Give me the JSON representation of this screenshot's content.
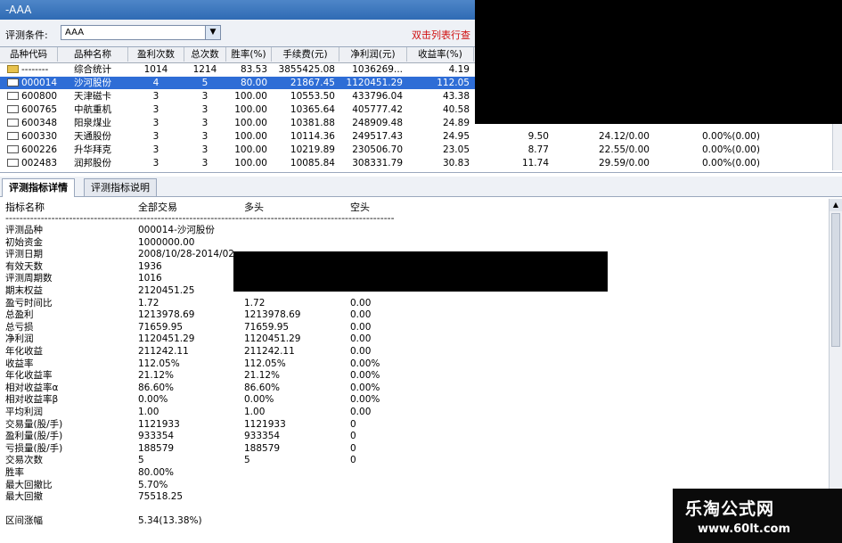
{
  "window": {
    "title": "-AAA"
  },
  "condition": {
    "label": "评测条件:",
    "value": "AAA",
    "hint": "双击列表行查"
  },
  "grid": {
    "headers": [
      "品种代码",
      "品种名称",
      "盈利次数",
      "总次数",
      "胜率(%)",
      "手续费(元)",
      "净利润(元)",
      "收益率(%)"
    ],
    "rows": [
      {
        "code": "--------",
        "name": "综合统计",
        "wins": "1014",
        "total": "1214",
        "rate": "83.53",
        "fee": "3855425.08",
        "profit": "1036269...",
        "ret": "4.19",
        "c9": "",
        "c10": "",
        "c11": "",
        "icon": "folder"
      },
      {
        "code": "000014",
        "name": "沙河股份",
        "wins": "4",
        "total": "5",
        "rate": "80.00",
        "fee": "21867.45",
        "profit": "1120451.29",
        "ret": "112.05",
        "c9": "",
        "c10": "",
        "c11": "",
        "icon": "doc"
      },
      {
        "code": "600800",
        "name": "天津磁卡",
        "wins": "3",
        "total": "3",
        "rate": "100.00",
        "fee": "10553.50",
        "profit": "433796.04",
        "ret": "43.38",
        "c9": "",
        "c10": "",
        "c11": "",
        "icon": "doc"
      },
      {
        "code": "600765",
        "name": "中航重机",
        "wins": "3",
        "total": "3",
        "rate": "100.00",
        "fee": "10365.64",
        "profit": "405777.42",
        "ret": "40.58",
        "c9": "",
        "c10": "",
        "c11": "",
        "icon": "doc"
      },
      {
        "code": "600348",
        "name": "阳泉煤业",
        "wins": "3",
        "total": "3",
        "rate": "100.00",
        "fee": "10381.88",
        "profit": "248909.48",
        "ret": "24.89",
        "c9": "",
        "c10": "",
        "c11": "",
        "icon": "doc"
      },
      {
        "code": "600330",
        "name": "天通股份",
        "wins": "3",
        "total": "3",
        "rate": "100.00",
        "fee": "10114.36",
        "profit": "249517.43",
        "ret": "24.95",
        "c9": "9.50",
        "c10": "24.12/0.00",
        "c11": "0.00%(0.00)",
        "icon": "doc"
      },
      {
        "code": "600226",
        "name": "升华拜克",
        "wins": "3",
        "total": "3",
        "rate": "100.00",
        "fee": "10219.89",
        "profit": "230506.70",
        "ret": "23.05",
        "c9": "8.77",
        "c10": "22.55/0.00",
        "c11": "0.00%(0.00)",
        "icon": "doc"
      },
      {
        "code": "002483",
        "name": "润邦股份",
        "wins": "3",
        "total": "3",
        "rate": "100.00",
        "fee": "10085.84",
        "profit": "308331.79",
        "ret": "30.83",
        "c9": "11.74",
        "c10": "29.59/0.00",
        "c11": "0.00%(0.00)",
        "icon": "doc"
      }
    ]
  },
  "tabs": [
    "评测指标详情",
    "评测指标说明"
  ],
  "detail": {
    "headers": [
      "指标名称",
      "全部交易",
      "多头",
      "空头"
    ],
    "separator": "----------------------------------------------------------------------------------------------------------------------------------------------",
    "rows": [
      {
        "name": "评测品种",
        "all": "000014-沙河股份",
        "long": "",
        "short": ""
      },
      {
        "name": "初始资金",
        "all": "1000000.00",
        "long": "",
        "short": ""
      },
      {
        "name": "评测日期",
        "all": "2008/10/28-2014/02",
        "long": "",
        "short": ""
      },
      {
        "name": "有效天数",
        "all": "1936",
        "long": "",
        "short": ""
      },
      {
        "name": "评测周期数",
        "all": "1016",
        "long": "",
        "short": ""
      },
      {
        "name": "期末权益",
        "all": "2120451.25",
        "long": "",
        "short": ""
      },
      {
        "name": "盈亏时间比",
        "all": "1.72",
        "long": "1.72",
        "short": "0.00"
      },
      {
        "name": "总盈利",
        "all": "1213978.69",
        "long": "1213978.69",
        "short": "0.00"
      },
      {
        "name": "总亏损",
        "all": "71659.95",
        "long": "71659.95",
        "short": "0.00"
      },
      {
        "name": "净利润",
        "all": "1120451.29",
        "long": "1120451.29",
        "short": "0.00"
      },
      {
        "name": "年化收益",
        "all": "211242.11",
        "long": "211242.11",
        "short": "0.00"
      },
      {
        "name": "收益率",
        "all": "112.05%",
        "long": "112.05%",
        "short": "0.00%"
      },
      {
        "name": "年化收益率",
        "all": "21.12%",
        "long": "21.12%",
        "short": "0.00%"
      },
      {
        "name": "相对收益率α",
        "all": "86.60%",
        "long": "86.60%",
        "short": "0.00%"
      },
      {
        "name": "相对收益率β",
        "all": "0.00%",
        "long": "0.00%",
        "short": "0.00%"
      },
      {
        "name": "平均利润",
        "all": "1.00",
        "long": "1.00",
        "short": "0.00"
      },
      {
        "name": "交易量(股/手)",
        "all": "1121933",
        "long": "1121933",
        "short": "0"
      },
      {
        "name": "盈利量(股/手)",
        "all": "933354",
        "long": "933354",
        "short": "0"
      },
      {
        "name": "亏损量(股/手)",
        "all": "188579",
        "long": "188579",
        "short": "0"
      },
      {
        "name": "交易次数",
        "all": "5",
        "long": "5",
        "short": "0"
      },
      {
        "name": "胜率",
        "all": "80.00%",
        "long": "",
        "short": ""
      },
      {
        "name": "最大回撤比",
        "all": "5.70%",
        "long": "",
        "short": ""
      },
      {
        "name": "最大回撤",
        "all": "75518.25",
        "long": "",
        "short": ""
      },
      {
        "name": "",
        "all": "",
        "long": "",
        "short": ""
      },
      {
        "name": "区间涨幅",
        "all": "5.34(13.38%)",
        "long": "",
        "short": ""
      }
    ]
  },
  "watermark": {
    "line1": "乐淘公式网",
    "line2": "www.60lt.com"
  },
  "colors": {
    "title_bar": "#2f6bb4",
    "selection": "#2e6dd6",
    "hint": "#d01010"
  }
}
